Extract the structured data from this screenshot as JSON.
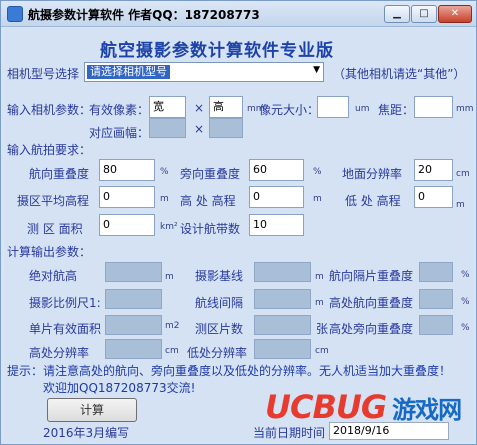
{
  "window": {
    "title": "航摄参数计算软件  作者QQ：187208773"
  },
  "header": {
    "title": "航空摄影参数计算软件专业版"
  },
  "camera": {
    "label": "相机型号选择",
    "selected": "请选择相机型号",
    "hint": "（其他相机请选“其他”）"
  },
  "input_camera": {
    "section": "输入相机参数：",
    "pixels_label": "有效像素：",
    "width_value": "宽",
    "height_value": "高",
    "unit_mm": "mm",
    "pixel_size_label": "像元大小：",
    "unit_um": "um",
    "focal_label": "焦距：",
    "unit_mm2": "mm",
    "frame_label": "对应画幅：",
    "times": "×"
  },
  "input_flight": {
    "section": "输入航拍要求：",
    "forward_overlap_label": "航向重叠度",
    "forward_overlap_value": "80",
    "side_overlap_label": "旁向重叠度",
    "side_overlap_value": "60",
    "percent": "%",
    "gsd_label": "地面分辨率",
    "gsd_value": "20",
    "unit_cm": "cm",
    "avg_elev_label": "摄区平均高程",
    "avg_elev_value": "0",
    "high_elev_label": "高 处 高程",
    "high_elev_value": "0",
    "low_elev_label": "低 处 高程",
    "low_elev_value": "0",
    "unit_m": "m",
    "area_label": "测 区 面积",
    "area_value": "0",
    "unit_km2": "km²",
    "strips_label": "设计航带数",
    "strips_value": "10"
  },
  "output": {
    "section": "计算输出参数：",
    "abs_height": "绝对航高",
    "baseline": "摄影基线",
    "forward_overlap_at": "航向隔片重叠度",
    "scale": "摄影比例尺1:",
    "line_spacing": "航线间隔",
    "high_forward": "高处航向重叠度",
    "single_area": "单片有效面积",
    "photo_count": "测区片数",
    "unit_m2": "m2",
    "unit_zhang": "张",
    "high_side": "高处旁向重叠度",
    "high_res": "高处分辨率",
    "low_res": "低处分辨率"
  },
  "footer": {
    "tip": "提示：请注意高处的航向、旁向重叠度以及低处的分辨率。无人机适当加大重叠度！",
    "welcome": "欢迎加QQ187208773交流!",
    "calc_button": "计算",
    "version": "2016年3月编写",
    "date_label": "当前日期时间",
    "date_value": "2018/9/16"
  },
  "watermark": {
    "brand": "UCBUG",
    "cn": "游戏网"
  }
}
